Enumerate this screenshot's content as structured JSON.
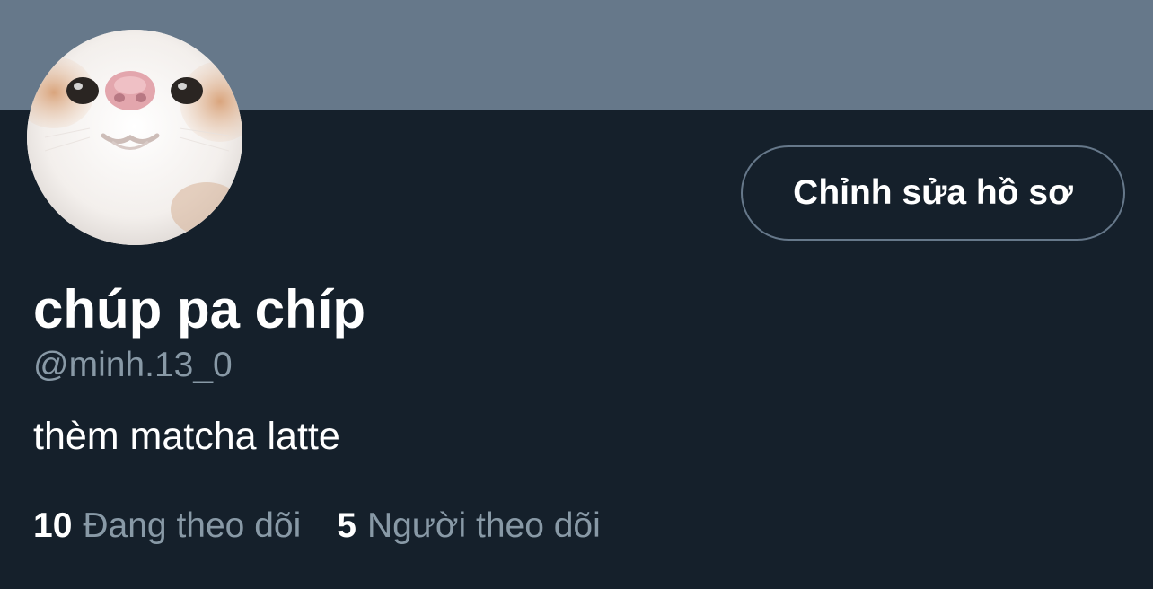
{
  "profile": {
    "display_name": "chúp pa chíp",
    "handle": "@minh.13_0",
    "bio": "thèm matcha latte",
    "edit_button_label": "Chỉnh sửa hồ sơ",
    "avatar_description": "cat-face-photo"
  },
  "stats": {
    "following": {
      "count": "10",
      "label": "Đang theo dõi"
    },
    "followers": {
      "count": "5",
      "label": "Người theo dõi"
    }
  },
  "colors": {
    "background": "#15202b",
    "banner": "#66788a",
    "primary_text": "#ffffff",
    "secondary_text": "#8899a6",
    "button_border": "#66788a"
  }
}
